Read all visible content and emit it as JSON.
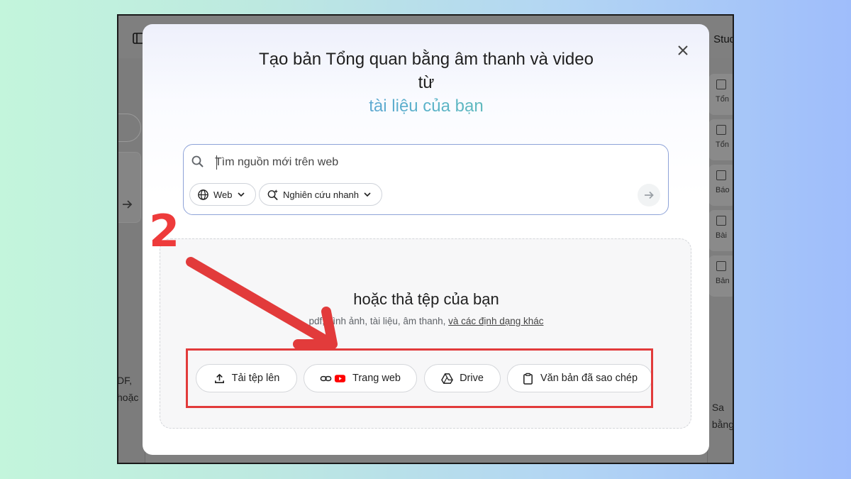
{
  "background_app": {
    "right_header": "Stud",
    "left_text": [
      "DF,",
      "hoặc"
    ],
    "right_tiles": [
      "Tổn",
      "Tổn",
      "Báo",
      "Bài",
      "Bản"
    ],
    "right_text": [
      "Sa",
      "bằng"
    ]
  },
  "dialog": {
    "title_line1": "Tạo bản Tổng quan bằng âm thanh và video",
    "title_line2": "từ",
    "title_accent": "tài liệu của bạn",
    "search": {
      "placeholder": "Tìm nguồn mới trên web",
      "chip_web": "Web",
      "chip_research": "Nghiên cứu nhanh"
    },
    "dropzone": {
      "title": "hoặc thả tệp của bạn",
      "subtitle": "pdf, hình ảnh, tài liệu, âm thanh,",
      "subtitle_link": "và các định dạng khác",
      "buttons": {
        "upload": "Tải tệp lên",
        "website": "Trang web",
        "drive": "Drive",
        "paste": "Văn bản đã sao chép"
      }
    }
  },
  "annotation": {
    "step": "2",
    "color": "#e23b3b"
  },
  "colors": {
    "accent_start": "#6b8ee8",
    "accent_end": "#6acb9d",
    "youtube_red": "#ff0000"
  }
}
